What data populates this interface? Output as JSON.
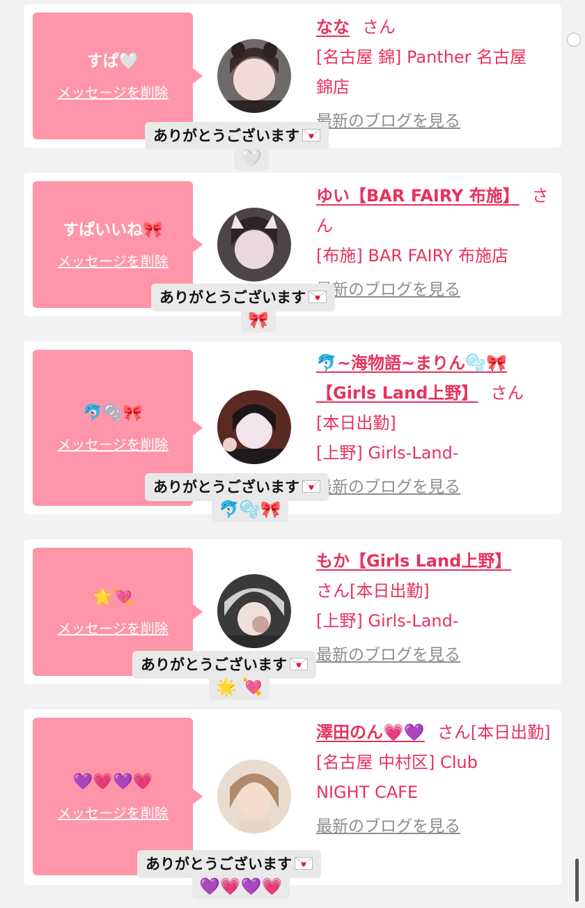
{
  "cards": [
    {
      "message": "すぱ🤍",
      "delete_label": "メッセージを削除",
      "name": "なな",
      "san": "さん",
      "shop_lines": [
        "[名古屋 錦] Panther 名古屋",
        "錦店"
      ],
      "blog_label": "最新のブログを見る",
      "reply_text": "ありがとうございます",
      "reply_emoji": "🤍"
    },
    {
      "message": "すぱいいね🎀",
      "delete_label": "メッセージを削除",
      "name": "ゆい【BAR FAIRY 布施】",
      "san": "さん",
      "shop_lines": [
        "[布施] BAR FAIRY 布施店"
      ],
      "blog_label": "最新のブログを見る",
      "reply_text": "ありがとうございます",
      "reply_emoji": "🎀"
    },
    {
      "message": "🐬🫧🎀",
      "delete_label": "メッセージを削除",
      "name": "🐬~海物語~まりん🫧🎀【Girls Land上野】",
      "san": "さん",
      "shop_lines": [
        "[本日出勤]",
        "[上野] Girls-Land-"
      ],
      "blog_label": "最新のブログを見る",
      "reply_text": "ありがとうございます",
      "reply_emoji": "🐬🫧🎀"
    },
    {
      "message": "🌟💘",
      "delete_label": "メッセージを削除",
      "name": "もか【Girls Land上野】",
      "san": "さん[本日出勤]",
      "shop_lines": [
        "[上野] Girls-Land-"
      ],
      "blog_label": "最新のブログを見る",
      "reply_text": "ありがとうございます",
      "reply_emoji": "🌟 💘"
    },
    {
      "message": "💜💗💜💗",
      "delete_label": "メッセージを削除",
      "name": "澤田のん💗💜",
      "san": "さん[本日出勤]",
      "shop_lines": [
        "[名古屋 中村区] Club",
        "NIGHT CAFE"
      ],
      "blog_label": "最新のブログを見る",
      "reply_text": "ありがとうございます",
      "reply_emoji": "💜💗💜💗"
    }
  ],
  "colors": {
    "accent": "#e8315c",
    "message_box": "#ff95a8",
    "background": "#f2f2f2",
    "link_gray": "#8c8c8c"
  }
}
